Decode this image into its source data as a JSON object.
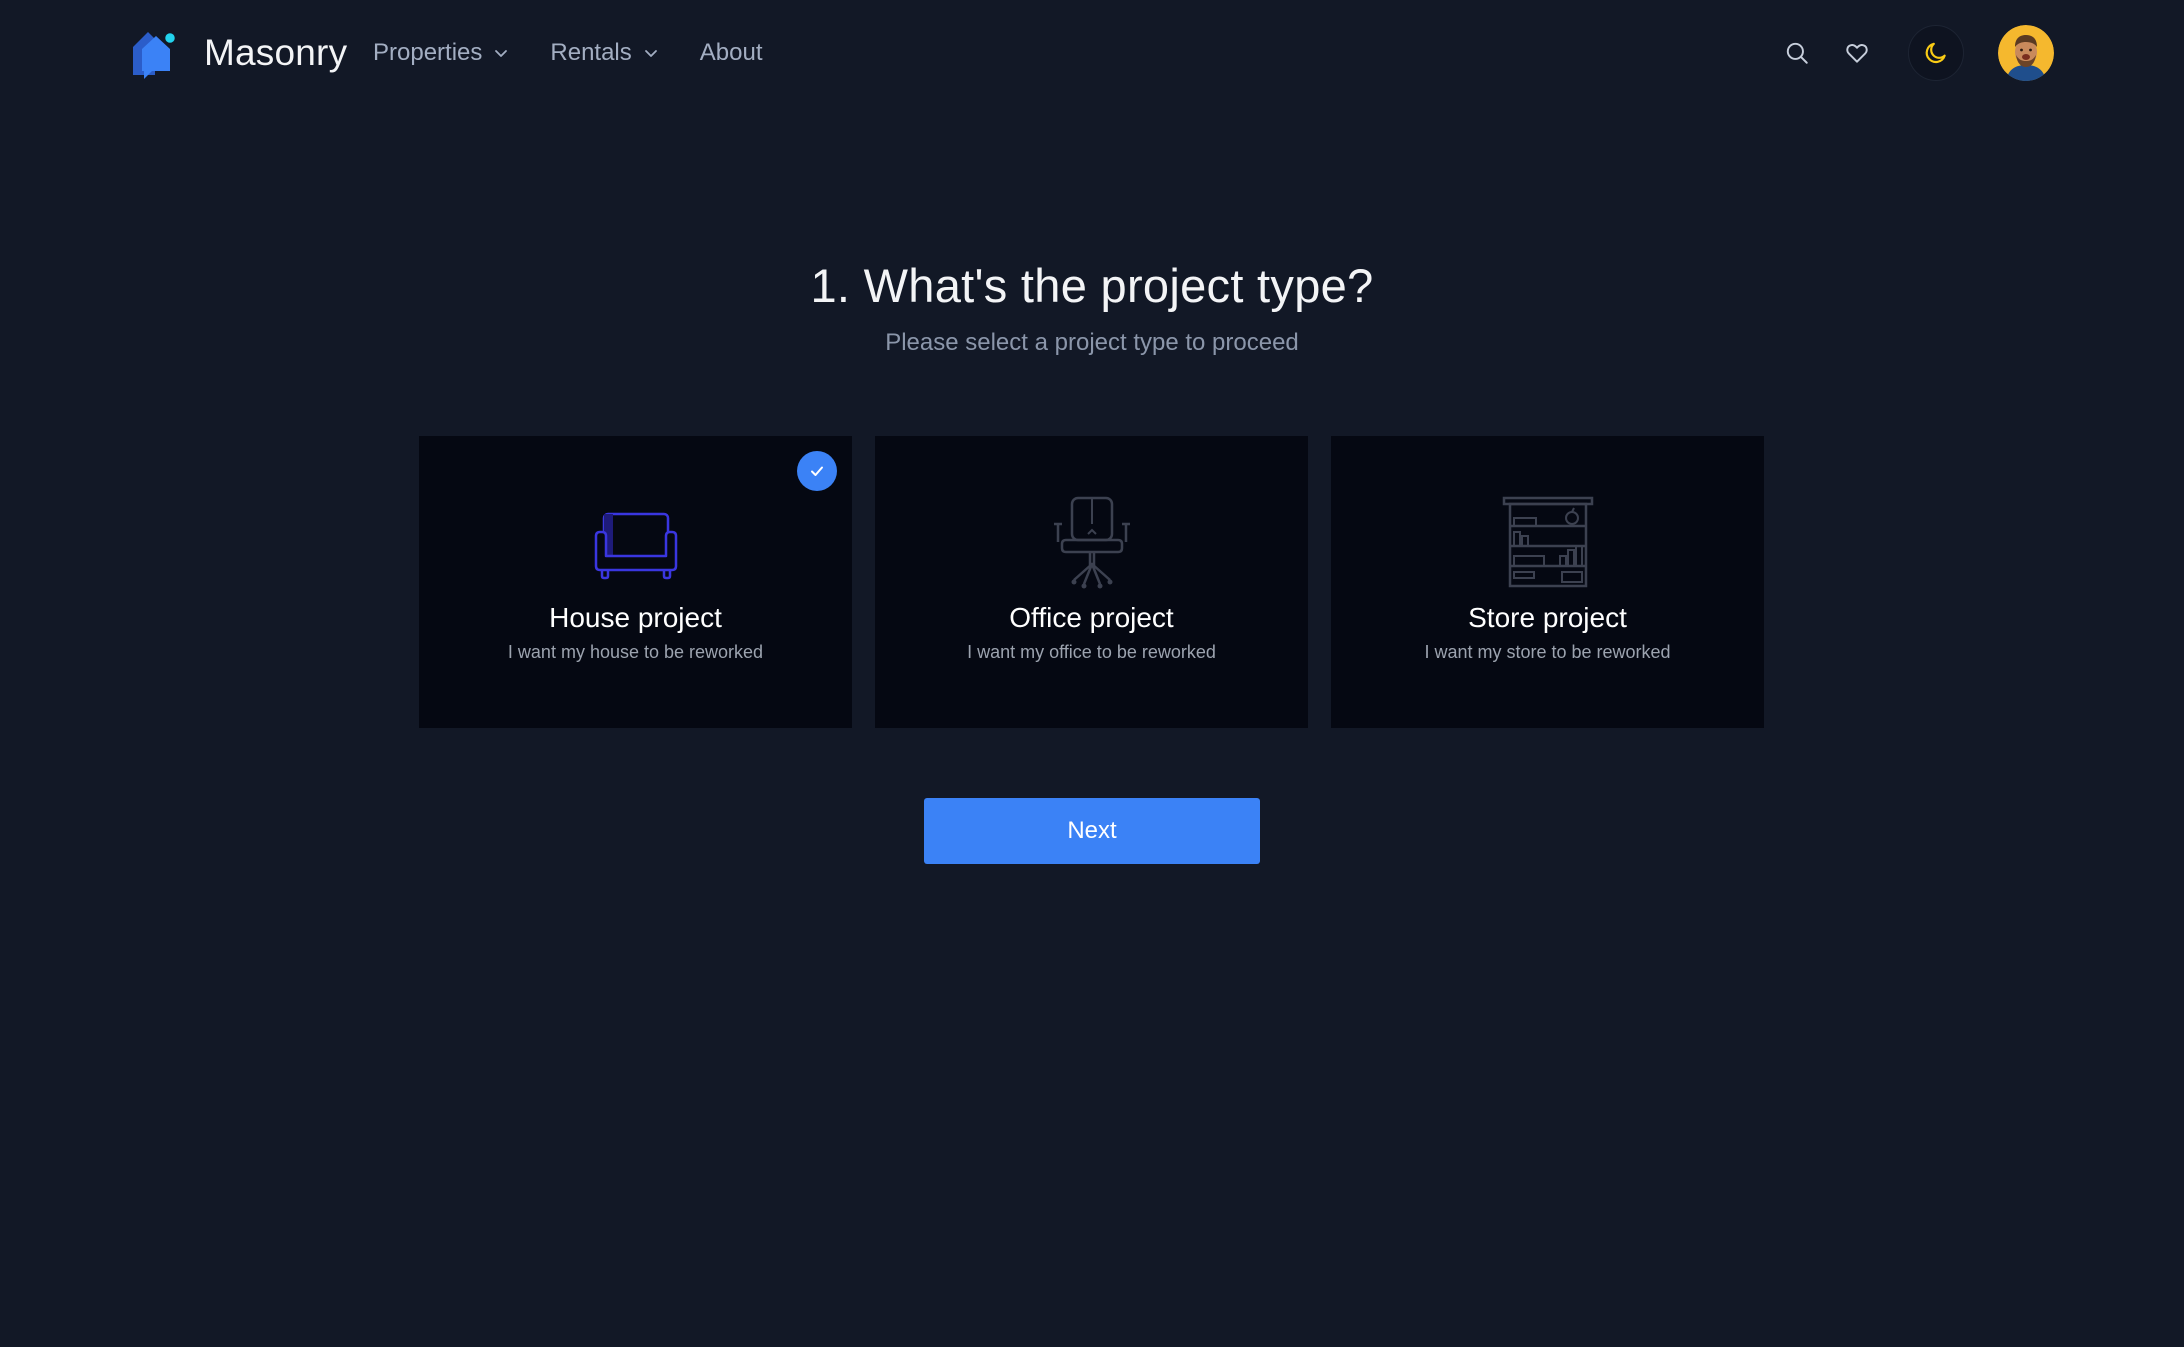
{
  "brand": {
    "name": "Masonry",
    "logo_icon": "house-logo-icon"
  },
  "nav": {
    "items": [
      {
        "label": "Properties",
        "has_dropdown": true
      },
      {
        "label": "Rentals",
        "has_dropdown": true
      },
      {
        "label": "About",
        "has_dropdown": false
      }
    ]
  },
  "header_icons": [
    "search-icon",
    "heart-icon",
    "moon-icon",
    "avatar"
  ],
  "page": {
    "title": "1. What's the project type?",
    "subtitle": "Please select a project type to proceed"
  },
  "project_types": [
    {
      "title": "House project",
      "description": "I want my house to be reworked",
      "icon": "sofa-icon",
      "selected": true
    },
    {
      "title": "Office project",
      "description": "I want my office to be reworked",
      "icon": "office-chair-icon",
      "selected": false
    },
    {
      "title": "Store project",
      "description": "I want my store to be reworked",
      "icon": "store-shelf-icon",
      "selected": false
    }
  ],
  "next_button": {
    "label": "Next"
  },
  "colors": {
    "background": "#121826",
    "card_background": "#050812",
    "accent": "#3b82f6",
    "selected_icon": "#3a36e0",
    "theme_icon": "#facc15"
  }
}
